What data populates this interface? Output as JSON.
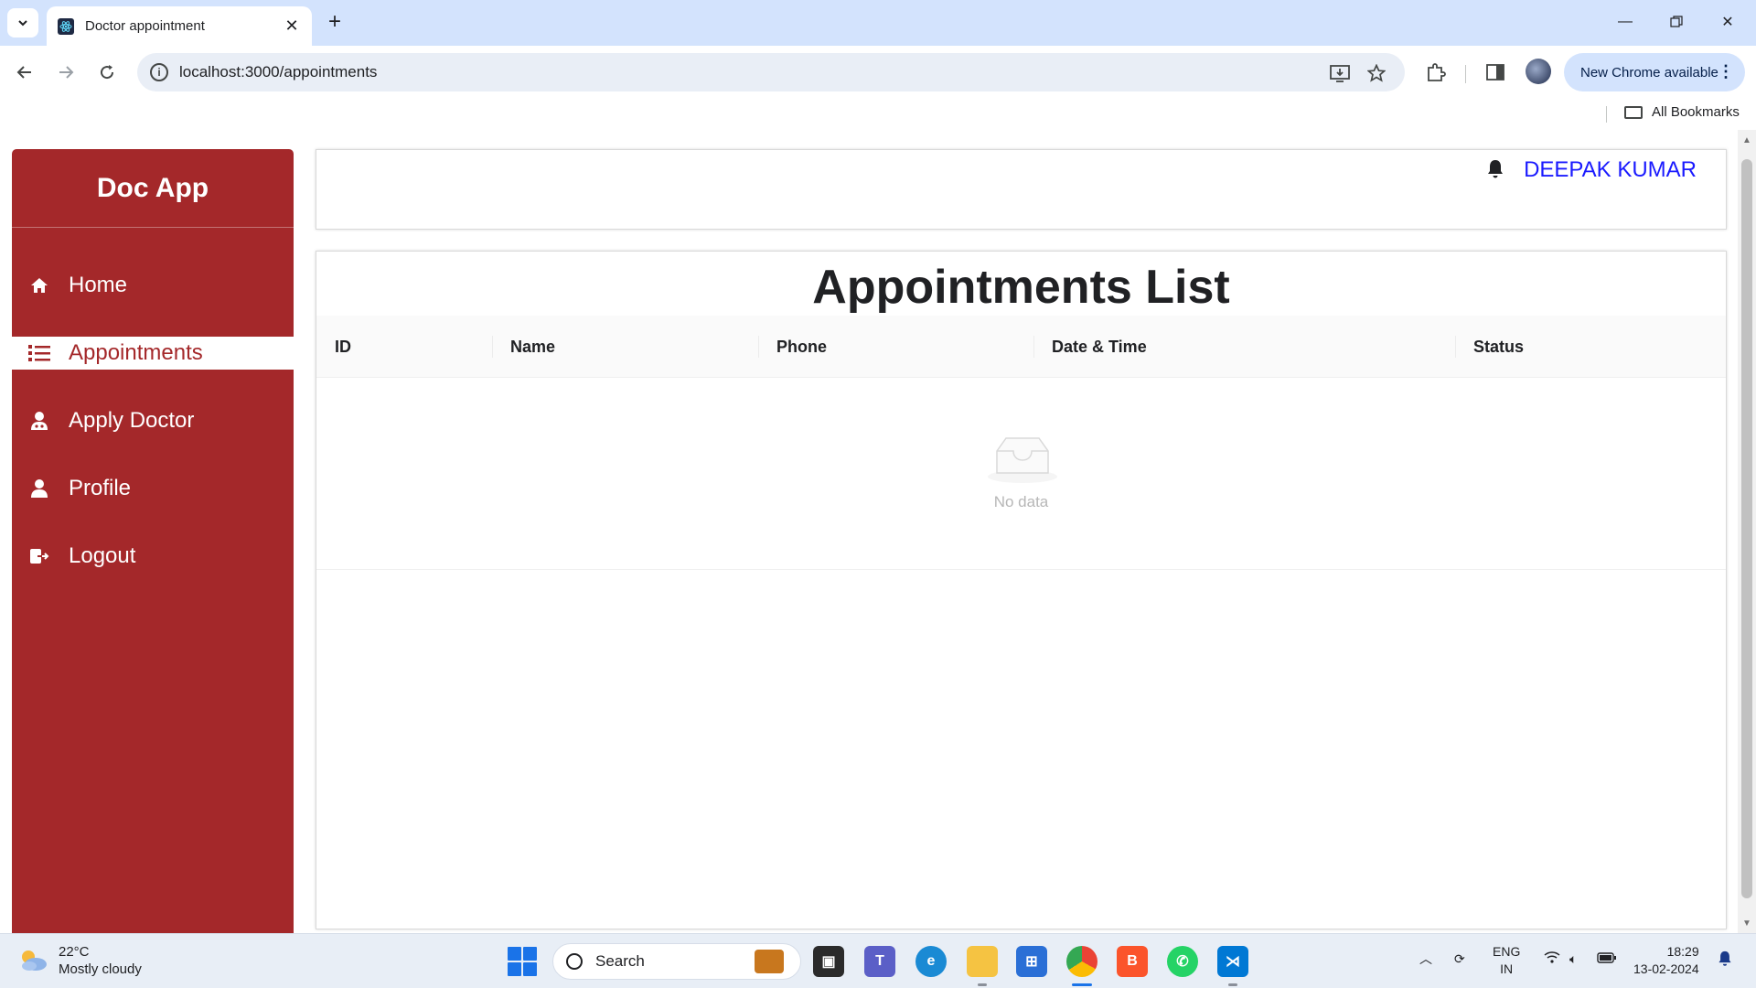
{
  "browser": {
    "tab_title": "Doctor appointment",
    "url": "localhost:3000/appointments",
    "new_chrome_label": "New Chrome available",
    "bookmarks_label": "All Bookmarks"
  },
  "app": {
    "logo": "Doc App",
    "user_name": "DEEPAK KUMAR",
    "menu": [
      {
        "label": "Home",
        "icon": "home-icon",
        "active": false
      },
      {
        "label": "Appointments",
        "icon": "list-icon",
        "active": true
      },
      {
        "label": "Apply Doctor",
        "icon": "doctor-icon",
        "active": false
      },
      {
        "label": "Profile",
        "icon": "user-icon",
        "active": false
      },
      {
        "label": "Logout",
        "icon": "logout-icon",
        "active": false
      }
    ],
    "brand_color": "#a4282a",
    "username_color": "#1a1aff"
  },
  "appointments": {
    "title": "Appointments List",
    "columns": [
      "ID",
      "Name",
      "Phone",
      "Date & Time",
      "Status"
    ],
    "rows": [],
    "empty_text": "No data"
  },
  "taskbar": {
    "temperature": "22°C",
    "weather": "Mostly cloudy",
    "search_placeholder": "Search",
    "lang_top": "ENG",
    "lang_bottom": "IN",
    "time": "18:29",
    "date": "13-02-2024"
  }
}
